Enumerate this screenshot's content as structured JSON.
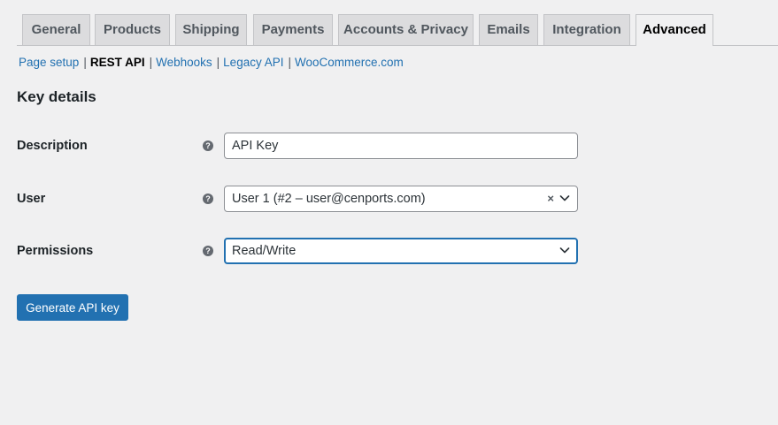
{
  "tabs": [
    {
      "label": "General"
    },
    {
      "label": "Products"
    },
    {
      "label": "Shipping"
    },
    {
      "label": "Payments"
    },
    {
      "label": "Accounts & Privacy"
    },
    {
      "label": "Emails"
    },
    {
      "label": "Integration"
    },
    {
      "label": "Advanced",
      "active": true
    }
  ],
  "subnav": {
    "items": [
      {
        "label": "Page setup"
      },
      {
        "label": "REST API",
        "current": true
      },
      {
        "label": "Webhooks"
      },
      {
        "label": "Legacy API"
      },
      {
        "label": "WooCommerce.com"
      }
    ],
    "separator": "|"
  },
  "section": {
    "title": "Key details"
  },
  "form": {
    "description": {
      "label": "Description",
      "value": "API Key"
    },
    "user": {
      "label": "User",
      "value": "User 1 (#2 – user@cenports.com)",
      "clear_glyph": "×"
    },
    "permissions": {
      "label": "Permissions",
      "value": "Read/Write"
    },
    "help_glyph": "?"
  },
  "actions": {
    "generate_label": "Generate API key"
  },
  "colors": {
    "accent": "#2271b1",
    "background": "#f0f0f1",
    "tab_inactive": "#dcdcde"
  },
  "icons": {
    "help": "help-circle-icon",
    "dropdown": "chevron-down-icon",
    "clear": "clear-x-icon"
  }
}
